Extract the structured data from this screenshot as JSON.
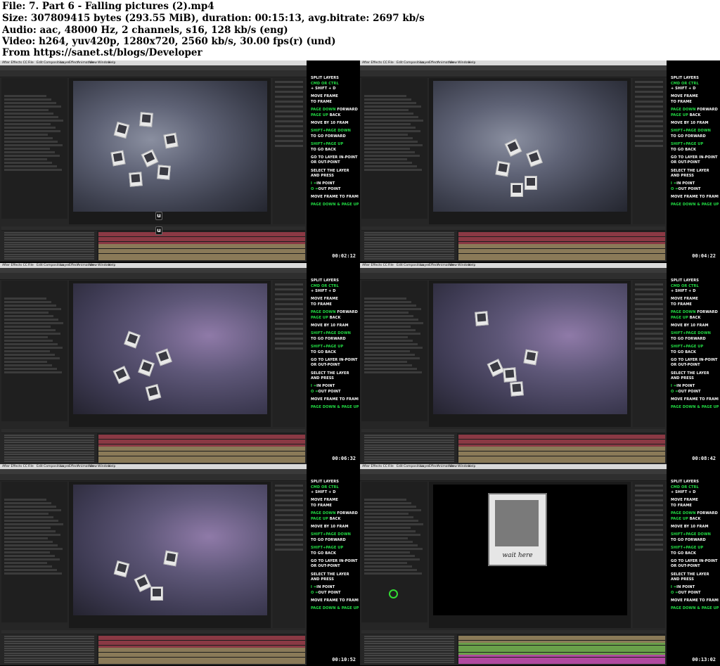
{
  "header": {
    "file": "File: 7. Part 6 - Falling pictures (2).mp4",
    "size": "Size: 307809415 bytes (293.55 MiB), duration: 00:15:13, avg.bitrate: 2697 kb/s",
    "audio": "Audio: aac, 48000 Hz, 2 channels, s16, 128 kb/s (eng)",
    "video": "Video: h264, yuv420p, 1280x720, 2560 kb/s, 30.00 fps(r) (und)",
    "from": "From https://sanet.st/blogs/Developer"
  },
  "menu": [
    "After Effects CC",
    "File",
    "Edit",
    "Composition",
    "Layer",
    "Effect",
    "Animation",
    "View",
    "Window",
    "Help"
  ],
  "sidebar_lines": [
    {
      "a": "SPLIT LAYERS",
      "c": "w"
    },
    {
      "a": "CMD OR CTRL",
      "c": "g"
    },
    {
      "a": "+ SHIFT + D",
      "c": "w"
    },
    {
      "a": "",
      "c": "w"
    },
    {
      "a": "MOVE FRAME",
      "c": "w"
    },
    {
      "a": "TO FRAME",
      "c": "w"
    },
    {
      "a": "",
      "c": "w"
    },
    {
      "a": "PAGE DOWN",
      "b": " FORWARD",
      "c": "g"
    },
    {
      "a": "PAGE UP",
      "b": " BACK",
      "c": "g"
    },
    {
      "a": "",
      "c": "w"
    },
    {
      "a": "MOVE BY 10 FRAM",
      "c": "w"
    },
    {
      "a": "",
      "c": "w"
    },
    {
      "a": "SHIFT+PAGE DOWN",
      "c": "g"
    },
    {
      "a": "TO GO FORWARD",
      "c": "w"
    },
    {
      "a": "",
      "c": "w"
    },
    {
      "a": "SHIFT+PAGE UP",
      "c": "g"
    },
    {
      "a": "TO GO BACK",
      "c": "w"
    },
    {
      "a": "",
      "c": "w"
    },
    {
      "a": "GO TO LAYER IN-POINT",
      "c": "w"
    },
    {
      "a": "OR OUT-POINT",
      "c": "w"
    },
    {
      "a": "",
      "c": "w"
    },
    {
      "a": "SELECT THE LAYER",
      "c": "w"
    },
    {
      "a": "AND PRESS",
      "c": "w"
    },
    {
      "a": "",
      "c": "w"
    },
    {
      "a": "I =",
      "b": "IN POINT",
      "c": "g"
    },
    {
      "a": "O =",
      "b": "OUT POINT",
      "c": "g"
    },
    {
      "a": "",
      "c": "w"
    },
    {
      "a": "MOVE  FRAME TO FRAME",
      "c": "w"
    },
    {
      "a": "",
      "c": "w"
    },
    {
      "a": "PAGE DOWN & PAGE UP",
      "c": "g"
    }
  ],
  "thumbs": [
    {
      "timestamp": "00:02:12",
      "variant": "blue",
      "keys": [
        "u",
        "u"
      ]
    },
    {
      "timestamp": "00:04:22",
      "variant": "blue",
      "keys": []
    },
    {
      "timestamp": "00:06:32",
      "variant": "purple",
      "keys": []
    },
    {
      "timestamp": "00:08:42",
      "variant": "purple",
      "keys": []
    },
    {
      "timestamp": "00:10:52",
      "variant": "purple",
      "keys": []
    },
    {
      "timestamp": "00:13:02",
      "variant": "black",
      "keys": [],
      "caption": "wait here"
    }
  ],
  "colors": {
    "green_text": "#22dd44",
    "bar_red": "#8a3944",
    "bar_tan": "#8a7a58"
  }
}
